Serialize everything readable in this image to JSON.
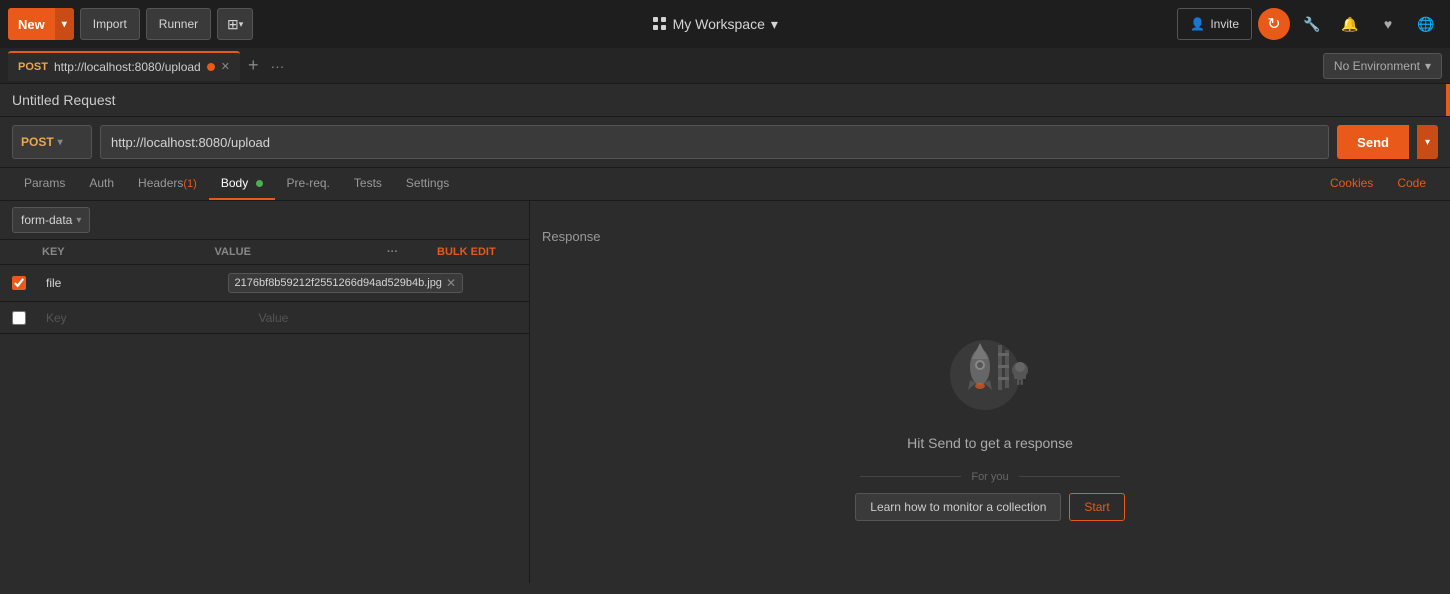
{
  "topnav": {
    "new_label": "New",
    "import_label": "Import",
    "runner_label": "Runner",
    "workspace_name": "My Workspace",
    "invite_label": "Invite"
  },
  "tab": {
    "method": "POST",
    "url": "http://localhost:8080/upload",
    "has_dot": true
  },
  "environment": {
    "label": "No Environment"
  },
  "request": {
    "title": "Untitled Request",
    "method": "POST",
    "url": "http://localhost:8080/upload",
    "send_label": "Send"
  },
  "request_tabs": {
    "params": "Params",
    "auth": "Auth",
    "headers": "Headers",
    "headers_badge": "(1)",
    "body": "Body",
    "prereq": "Pre-req.",
    "tests": "Tests",
    "settings": "Settings",
    "cookies": "Cookies",
    "code": "Code"
  },
  "body": {
    "type": "form-data",
    "columns": {
      "key": "KEY",
      "value": "VALUE",
      "bulk_edit": "Bulk Edit"
    },
    "rows": [
      {
        "checked": true,
        "key": "file",
        "value": "2176bf8b59212f2551266d94ad529b4b.jpg",
        "is_file": true
      },
      {
        "checked": false,
        "key": "Key",
        "value": "Value",
        "is_placeholder": true
      }
    ]
  },
  "response": {
    "title": "Response",
    "empty_message": "Hit Send to get a response",
    "for_you_label": "For you",
    "monitor_label": "Learn how to monitor a collection",
    "start_label": "Start"
  },
  "icons": {
    "dropdown_arrow": "▾",
    "grid": "⊞",
    "user": "👤",
    "sync": "↻",
    "wrench": "🔧",
    "bell": "🔔",
    "heart": "♥",
    "globe": "🌐"
  }
}
